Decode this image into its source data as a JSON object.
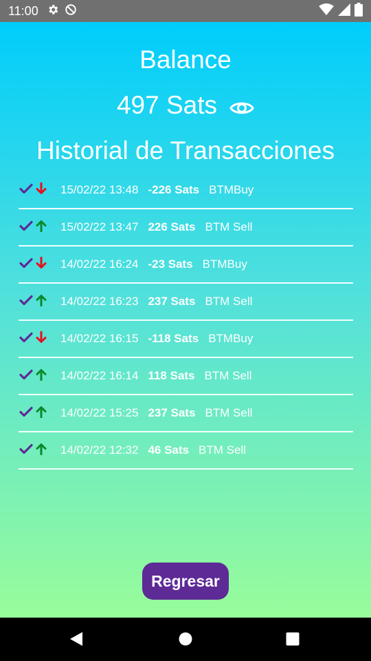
{
  "status_bar": {
    "time": "11:00",
    "icons": [
      "gear-icon",
      "do-not-disturb-icon",
      "wifi-icon",
      "signal-icon",
      "battery-icon"
    ]
  },
  "balance": {
    "title": "Balance",
    "amount": "497 Sats",
    "toggle_icon": "eye-icon"
  },
  "history": {
    "title": "Historial de Transacciones",
    "transactions": [
      {
        "direction": "down",
        "date": "15/02/22 13:48",
        "amount": "-226 Sats",
        "type": "BTMBuy"
      },
      {
        "direction": "up",
        "date": "15/02/22 13:47",
        "amount": "226 Sats",
        "type": "BTM Sell"
      },
      {
        "direction": "down",
        "date": "14/02/22 16:24",
        "amount": "-23 Sats",
        "type": "BTMBuy"
      },
      {
        "direction": "up",
        "date": "14/02/22 16:23",
        "amount": "237 Sats",
        "type": "BTM Sell"
      },
      {
        "direction": "down",
        "date": "14/02/22 16:15",
        "amount": "-118 Sats",
        "type": "BTMBuy"
      },
      {
        "direction": "up",
        "date": "14/02/22 16:14",
        "amount": "118 Sats",
        "type": "BTM Sell"
      },
      {
        "direction": "up",
        "date": "14/02/22 15:25",
        "amount": "237 Sats",
        "type": "BTM Sell"
      },
      {
        "direction": "up",
        "date": "14/02/22 12:32",
        "amount": "46 Sats",
        "type": "BTM Sell"
      }
    ]
  },
  "back_button": {
    "label": "Regresar"
  },
  "nav_bar": {
    "icons": [
      "back-icon",
      "home-icon",
      "recents-icon"
    ]
  },
  "colors": {
    "check": "#5d2a96",
    "arrow_up": "#0a8a2a",
    "arrow_down": "#e8101c",
    "button": "#5d2a96",
    "gradient_top": "#00cdfc",
    "gradient_bottom": "#98fc9a"
  }
}
